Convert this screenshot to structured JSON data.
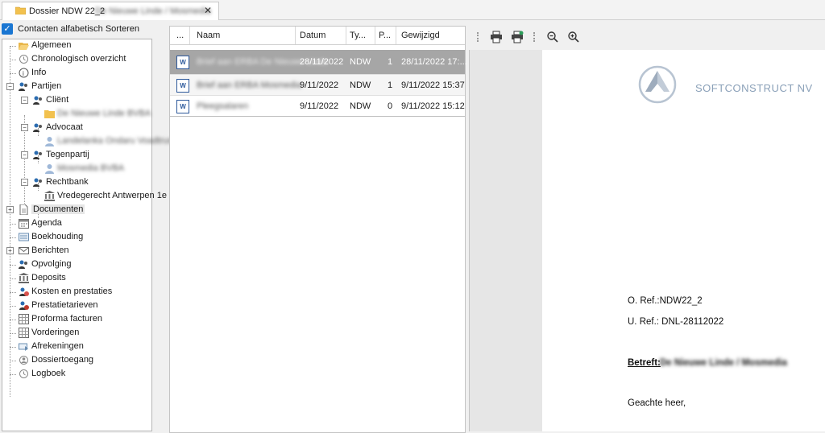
{
  "tab": {
    "title": "Dossier NDW 22_2",
    "subtitle": "De Nieuwe Linde / Mosmedia"
  },
  "sort": {
    "label": "Contacten alfabetisch Sorteren",
    "checked": true
  },
  "tree": {
    "algemeen": "Algemeen",
    "chronologisch": "Chronologisch overzicht",
    "info": "Info",
    "partijen": "Partijen",
    "client": "Cliënt",
    "client_child": "De Nieuwe Linde BVBA",
    "advocaat": "Advocaat",
    "advocaat_child": "Landelanka Ondaru Voadtrus",
    "tegenpartij": "Tegenpartij",
    "tegenpartij_child": "Mosmedia BVBA",
    "rechtbank": "Rechtbank",
    "rechtbank_child": "Vredegerecht Antwerpen 1e",
    "documenten": "Documenten",
    "agenda": "Agenda",
    "boekhouding": "Boekhouding",
    "berichten": "Berichten",
    "opvolging": "Opvolging",
    "deposits": "Deposits",
    "kosten": "Kosten en prestaties",
    "prestatietarieven": "Prestatietarieven",
    "proforma": "Proforma facturen",
    "vorderingen": "Vorderingen",
    "afrekeningen": "Afrekeningen",
    "dossiertoegang": "Dossiertoegang",
    "logboek": "Logboek"
  },
  "docs": {
    "columns": {
      "dots": "...",
      "naam": "Naam",
      "datum": "Datum",
      "type": "Ty...",
      "p": "P...",
      "gewijzigd": "Gewijzigd"
    },
    "rows": [
      {
        "naam": "Brief aan ERBA De Nieuwe Linde",
        "datum": "28/11/2022",
        "type": "NDW",
        "p": "1",
        "gewijzigd": "28/11/2022 17:..."
      },
      {
        "naam": "Brief aan ERBA Mosmedia",
        "datum": "9/11/2022",
        "type": "NDW",
        "p": "1",
        "gewijzigd": "9/11/2022 15:37"
      },
      {
        "naam": "Pleegsalaren",
        "datum": "9/11/2022",
        "type": "NDW",
        "p": "0",
        "gewijzigd": "9/11/2022 15:12"
      }
    ]
  },
  "preview": {
    "logo": "SOFTCONSTRUCT NV",
    "oref": "O. Ref.:NDW22_2",
    "uref": "U. Ref.: DNL-28112022",
    "betreft_label": "Betreft:",
    "betreft_value": "De Nieuwe Linde / Mosmedia",
    "greeting": "Geachte heer,"
  },
  "colors": {
    "accent": "#1976d2",
    "selected_row": "#a6a6a6",
    "word": "#2b579a"
  }
}
